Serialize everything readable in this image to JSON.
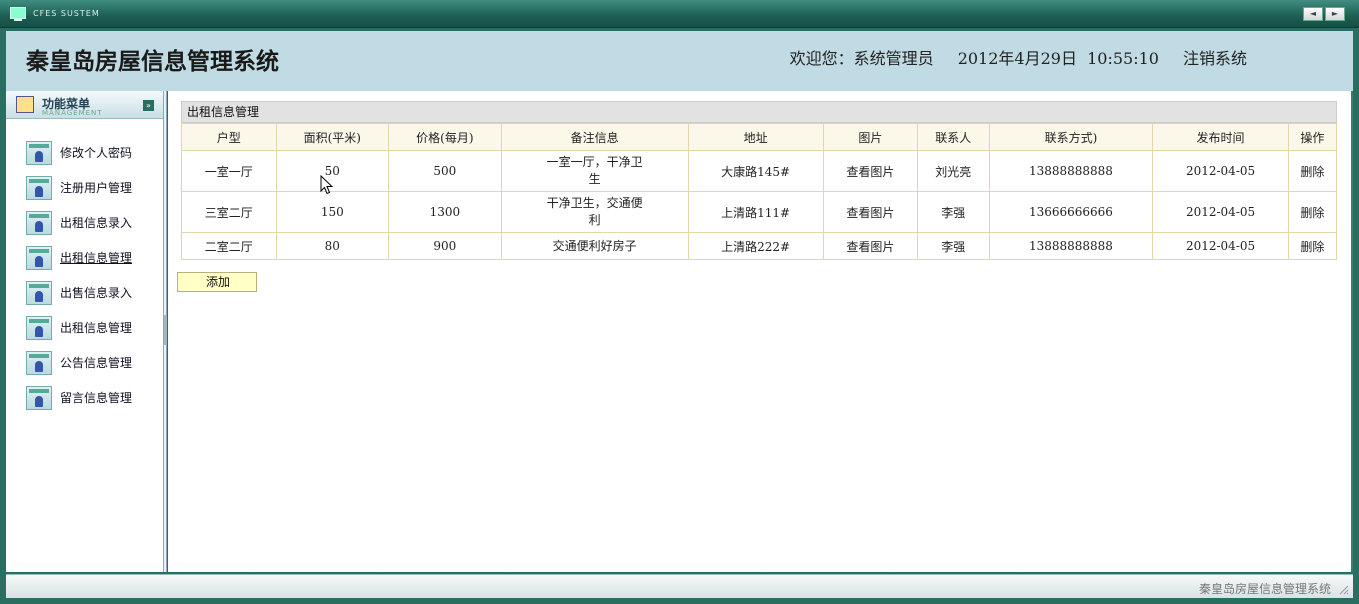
{
  "window": {
    "system_label": "CFES SUSTEM",
    "nav_prev": "◄",
    "nav_next": "►"
  },
  "header": {
    "title": "秦皇岛房屋信息管理系统",
    "welcome": "欢迎您：系统管理员",
    "datetime": "2012年4月29日  10:55:10",
    "logout": "注销系统"
  },
  "sidebar": {
    "title": "功能菜单",
    "subtitle": "MANAGEMENT",
    "collapse_glyph": "»",
    "items": [
      {
        "label": "修改个人密码",
        "icon": "user-card-icon"
      },
      {
        "label": "注册用户管理",
        "icon": "user-card-icon"
      },
      {
        "label": "出租信息录入",
        "icon": "user-card-icon"
      },
      {
        "label": "出租信息管理",
        "icon": "user-card-icon"
      },
      {
        "label": "出售信息录入",
        "icon": "user-card-icon"
      },
      {
        "label": "出租信息管理",
        "icon": "user-card-icon"
      },
      {
        "label": "公告信息管理",
        "icon": "user-card-icon"
      },
      {
        "label": "留言信息管理",
        "icon": "user-card-icon"
      }
    ]
  },
  "panel": {
    "title": "出租信息管理",
    "columns": [
      "户型",
      "面积(平米)",
      "价格(每月)",
      "备注信息",
      "地址",
      "图片",
      "联系人",
      "联系方式)",
      "发布时间",
      "操作"
    ],
    "rows": [
      [
        "一室一厅",
        "50",
        "500",
        "一室一厅，干净卫生",
        "大康路145#",
        "查看图片",
        "刘光亮",
        "13888888888",
        "2012-04-05",
        "删除"
      ],
      [
        "三室二厅",
        "150",
        "1300",
        "干净卫生，交通便利",
        "上清路111#",
        "查看图片",
        "李强",
        "13666666666",
        "2012-04-05",
        "删除"
      ],
      [
        "二室二厅",
        "80",
        "900",
        "交通便利好房子",
        "上清路222#",
        "查看图片",
        "李强",
        "13888888888",
        "2012-04-05",
        "删除"
      ]
    ],
    "add_label": "添加"
  },
  "status": {
    "text": "秦皇岛房屋信息管理系统"
  }
}
